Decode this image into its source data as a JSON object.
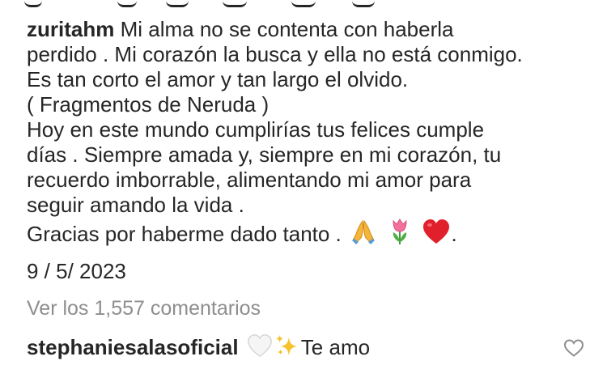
{
  "post_caption": {
    "username": "zuritahm",
    "lines": [
      "Mi alma no se contenta con haberla",
      "perdido . Mi corazón la busca y ella no está conmigo.",
      "Es tan corto el amor y tan largo el olvido.",
      "( Fragmentos de Neruda )",
      "Hoy en este mundo cumplirías tus felices cumple",
      "días . Siempre amada y, siempre en mi corazón, tu",
      "recuerdo imborrable, alimentando mi amor  para",
      "seguir amando la vida .",
      "Gracias por haberme dado tanto ."
    ],
    "trailing_period": ".",
    "emojis": [
      "praying-hands",
      "tulip",
      "red-heart"
    ],
    "date": "9 / 5/ 2023"
  },
  "comments_link": {
    "label": "Ver los 1,557 comentarios"
  },
  "comment": {
    "username": "stephaniesalasoficial",
    "emojis": [
      "white-heart",
      "sparkles"
    ],
    "text": "Te amo"
  },
  "colors": {
    "text": "#262626",
    "secondary": "#8e8e8e",
    "heart_red": "#e0202b"
  }
}
